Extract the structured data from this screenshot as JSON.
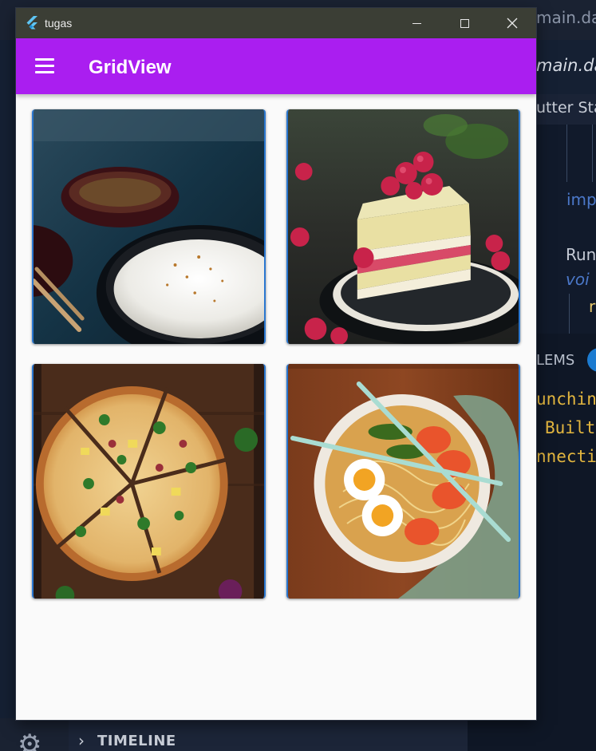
{
  "background_editor": {
    "tab_label": "main.dar",
    "file_label": "main.dart",
    "breadcrumb": "utter Sta",
    "code_lines": {
      "import_fragment": "imp",
      "run_fragment": "Run",
      "void_fragment": "voi",
      "r_fragment": "r"
    },
    "panel_title": "LEMS",
    "terminal_lines": [
      "unchin",
      "Built",
      "nnecti"
    ],
    "timeline_label": "TIMELINE"
  },
  "window": {
    "title": "tugas",
    "controls": {
      "minimize": "minimize",
      "maximize": "maximize",
      "close": "close"
    }
  },
  "app_bar": {
    "title": "GridView",
    "menu_icon": "menu-icon",
    "color": "#aa1ef0"
  },
  "grid": {
    "columns": 2,
    "items": [
      {
        "name": "rice-bowl",
        "icon": "food-image-rice"
      },
      {
        "name": "raspberry-cake",
        "icon": "food-image-cake"
      },
      {
        "name": "pizza",
        "icon": "food-image-pizza"
      },
      {
        "name": "ramen",
        "icon": "food-image-ramen"
      }
    ]
  },
  "colors": {
    "window_titlebar": "#3b3e35",
    "content_background": "#fafafa",
    "card_border": "#2a77d0"
  }
}
